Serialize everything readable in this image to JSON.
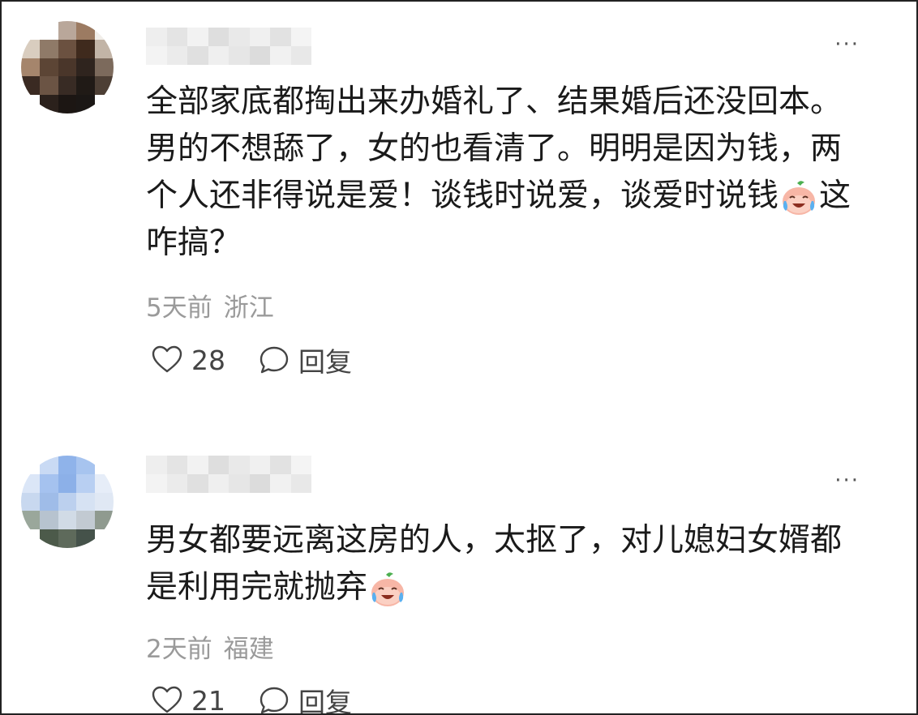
{
  "comments": [
    {
      "text": "全部家底都掏出来办婚礼了、结果婚后还没回本。男的不想舔了，女的也看清了。明明是因为钱，两个人还非得说是爱！谈钱时说爱，谈爱时说钱",
      "text_after_emoji": "这咋搞？",
      "time": "5天前",
      "location": "浙江",
      "likes": "28",
      "reply_label": "回复",
      "more_label": "···",
      "emoji": "crying-laughing-emoji",
      "avatar_colors": [
        "#ffffff",
        "#ffffff",
        "#b9a79a",
        "#9c7b62",
        "#f1eee9",
        "#d9cdbf",
        "#8f7a68",
        "#6b5140",
        "#3f2a1d",
        "#c2b4a6",
        "#a5856c",
        "#5c4535",
        "#4a362a",
        "#2f241e",
        "#7c6a5c",
        "#3a2a22",
        "#6b5444",
        "#382b24",
        "#201a16",
        "#4d3f35",
        "#ffffff",
        "#2b211c",
        "#1c1613",
        "#1b1715",
        "#ffffff"
      ]
    },
    {
      "text": "男女都要远离这房的人，太抠了，对儿媳妇女婿都是利用完就抛弃",
      "text_after_emoji": "",
      "time": "2天前",
      "location": "福建",
      "likes": "21",
      "reply_label": "回复",
      "more_label": "···",
      "emoji": "crying-laughing-emoji",
      "avatar_colors": [
        "#ffffff",
        "#c9daf4",
        "#8fb3ea",
        "#a7c4ef",
        "#ffffff",
        "#dbe6f7",
        "#a5c2ef",
        "#8cb0e8",
        "#b8cff2",
        "#e6edf8",
        "#c8d8ef",
        "#9fbce8",
        "#bcd0ee",
        "#d6e2f3",
        "#e0e8f4",
        "#9aa79b",
        "#b7c3cf",
        "#d1dbe6",
        "#c2cad2",
        "#8f9a8f",
        "#ffffff",
        "#4c5a4a",
        "#5e6a5b",
        "#45524a",
        "#ffffff"
      ]
    }
  ],
  "name_blur_colors": [
    "#eeeeee",
    "#e4e4e4",
    "#f2f2f2",
    "#dedede",
    "#e9e9e9",
    "#f0f0f0",
    "#e2e2e2",
    "#f4f4f4",
    "#f3f3f3",
    "#ebebeb",
    "#e0e0e0",
    "#efefef",
    "#e6e6e6",
    "#dcdcdc",
    "#f1f1f1",
    "#e8e8e8"
  ]
}
